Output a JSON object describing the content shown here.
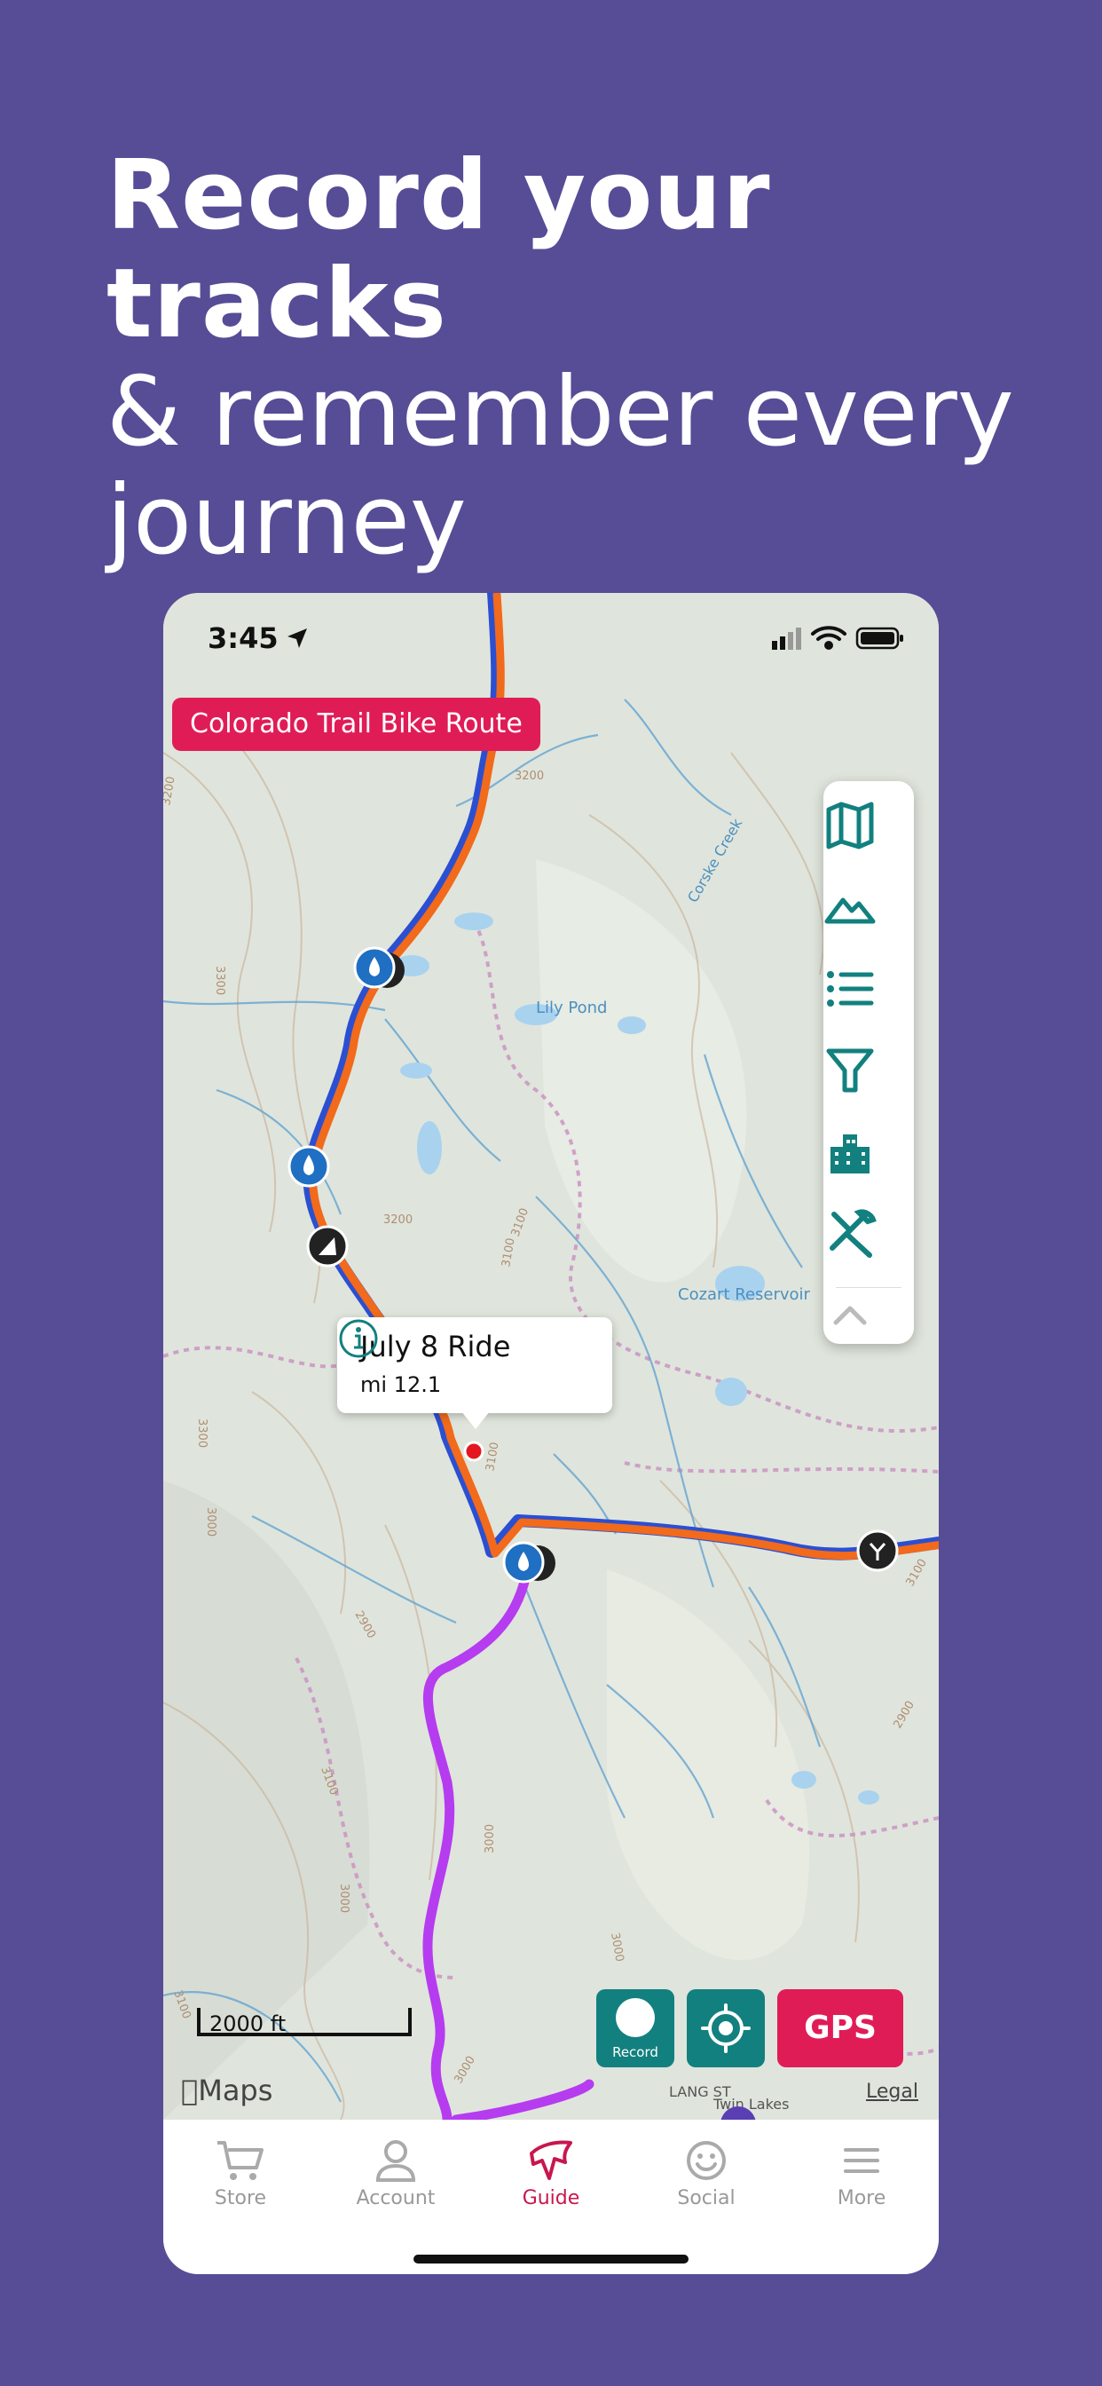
{
  "headline": {
    "line1": "Record your tracks",
    "line2": "& remember every",
    "line3": "journey"
  },
  "status_bar": {
    "time": "3:45"
  },
  "route_badge": "Colorado Trail Bike Route",
  "map": {
    "labels": {
      "lily_pond": "Lily Pond",
      "cozart_reservoir": "Cozart Reservoir",
      "corske_creek": "Corske Creek",
      "lang_st": "LANG ST",
      "twin_lakes": "Twin Lakes",
      "contours": [
        "3200",
        "3300",
        "3200",
        "3100",
        "3200",
        "3100",
        "3300",
        "3100",
        "3000",
        "3000",
        "3000",
        "3100",
        "2900",
        "3100",
        "2900",
        "3100",
        "3000",
        "3000"
      ]
    },
    "toolbar_icons": [
      "map-icon",
      "terrain-icon",
      "list-icon",
      "filter-icon",
      "buildings-icon",
      "tools-icon",
      "chevron-up-icon"
    ],
    "popup": {
      "title": "July 8 Ride",
      "subtitle": "mi 12.1"
    },
    "scale_label": "2000 ft",
    "attribution": "Maps",
    "legal": "Legal",
    "buttons": {
      "record": "Record",
      "gps": "GPS"
    },
    "colors": {
      "trail_orange": "#f26a1b",
      "trail_blue": "#2b4fd1",
      "track_purple": "#b63cf0",
      "brand_pink": "#e01c56",
      "teal": "#12807f"
    }
  },
  "tabs": [
    {
      "label": "Store",
      "icon": "cart-icon"
    },
    {
      "label": "Account",
      "icon": "person-icon"
    },
    {
      "label": "Guide",
      "icon": "guide-icon",
      "active": true
    },
    {
      "label": "Social",
      "icon": "smiley-icon"
    },
    {
      "label": "More",
      "icon": "menu-icon"
    }
  ]
}
